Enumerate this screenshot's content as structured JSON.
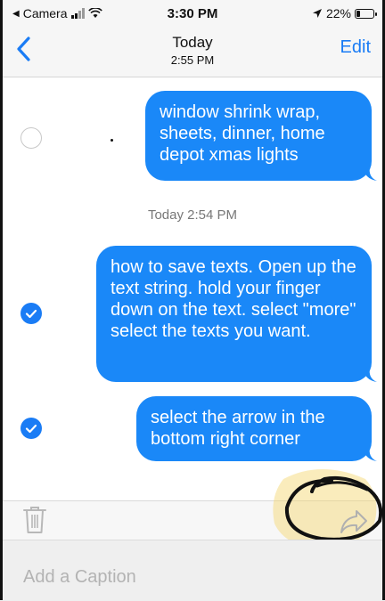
{
  "status_bar": {
    "back_app": "Camera",
    "time": "3:30 PM",
    "battery": "22%"
  },
  "nav": {
    "title": "Today",
    "subtitle": "2:55 PM",
    "edit_label": "Edit"
  },
  "messages": [
    {
      "text": "window shrink wrap, sheets, dinner, home depot xmas lights",
      "selected": false
    },
    {
      "text": "how to save texts. Open up the text string. hold your finger down on the text. select \"more\" select the texts you want.",
      "selected": true
    },
    {
      "text": "select the arrow in the bottom right corner",
      "selected": true
    }
  ],
  "timestamp": "Today 2:54 PM",
  "caption": {
    "placeholder": "Add a Caption"
  },
  "colors": {
    "bubble": "#1a88f8",
    "accent": "#1a7cf5",
    "highlight": "#f5d46a"
  }
}
